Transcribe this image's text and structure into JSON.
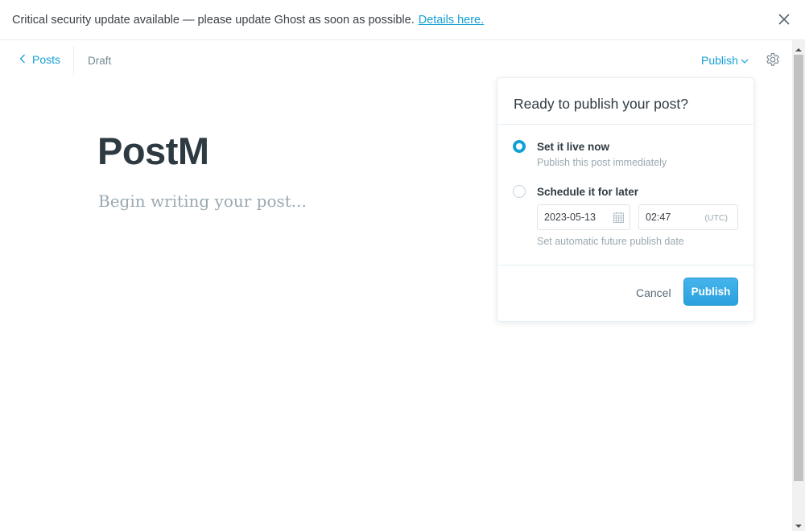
{
  "alert": {
    "message": "Critical security update available — please update Ghost as soon as possible.",
    "link_text": "Details here."
  },
  "header": {
    "back_label": "Posts",
    "status": "Draft",
    "publish_menu_label": "Publish"
  },
  "editor": {
    "title": "PostM",
    "body_placeholder": "Begin writing your post..."
  },
  "publish_popover": {
    "title": "Ready to publish your post?",
    "options": [
      {
        "label": "Set it live now",
        "description": "Publish this post immediately",
        "selected": true
      },
      {
        "label": "Schedule it for later",
        "description": "Set automatic future publish date",
        "selected": false
      }
    ],
    "date_value": "2023-05-13",
    "time_value": "02:47",
    "timezone": "(UTC)",
    "cancel_label": "Cancel",
    "publish_label": "Publish"
  },
  "colors": {
    "accent": "#14a0d6",
    "publish_button": "#2aa1dc",
    "title_text": "#2e3a41",
    "muted_text": "#9aa9b1"
  },
  "icons": [
    "close-icon",
    "chevron-left-icon",
    "chevron-down-icon",
    "gear-icon",
    "calendar-icon"
  ]
}
